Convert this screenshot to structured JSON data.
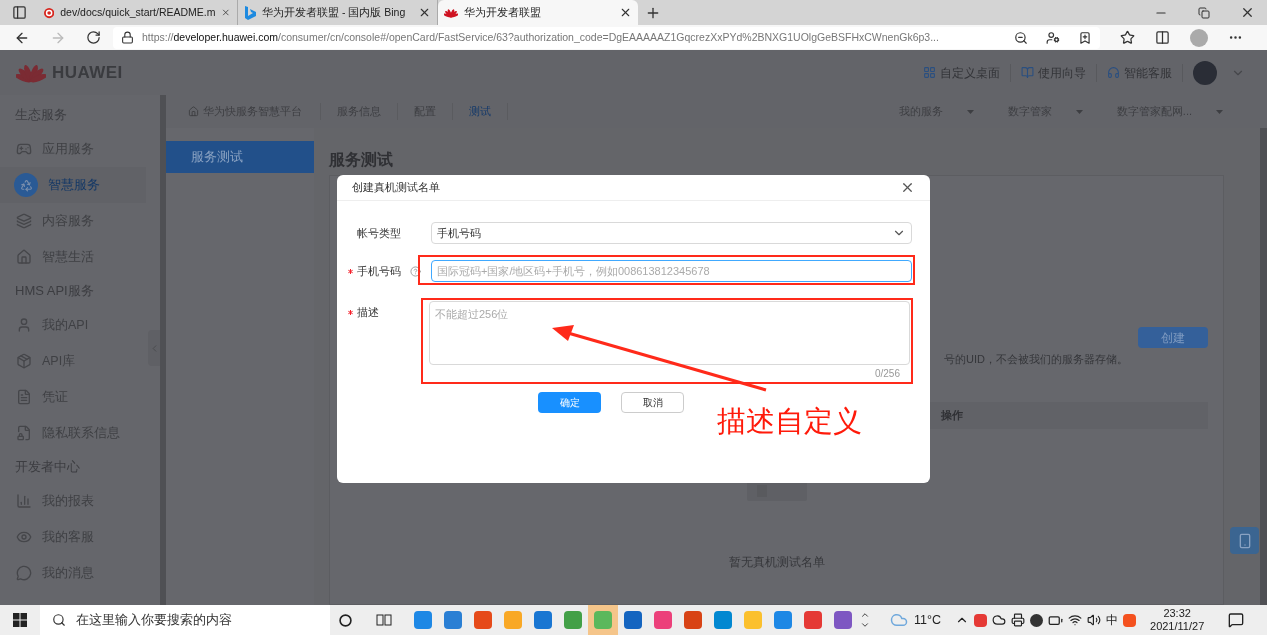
{
  "browser": {
    "tabs": [
      {
        "title": "dev/docs/quick_start/README.m",
        "selected": false
      },
      {
        "title": "华为开发者联盟 - 国内版 Bing",
        "selected": false
      },
      {
        "title": "华为开发者联盟",
        "selected": true
      }
    ],
    "url": {
      "scheme": "https://",
      "host": "developer.huawei.com",
      "path": "/consumer/cn/console#/openCard/FastService/63?authorization_code=DgEAAAAAZ1GqcrezXxPYd%2BNXG1UOlgGeBSFHxCWnenGk6p3..."
    }
  },
  "header": {
    "logo": "HUAWEI",
    "links": [
      {
        "label": "自定义桌面"
      },
      {
        "label": "使用向导"
      },
      {
        "label": "智能客服"
      }
    ]
  },
  "sidebar": {
    "sections": [
      {
        "title": "生态服务",
        "items": [
          {
            "label": "应用服务",
            "selected": false
          },
          {
            "label": "智慧服务",
            "selected": true
          },
          {
            "label": "内容服务",
            "selected": false
          },
          {
            "label": "智慧生活",
            "selected": false
          }
        ]
      },
      {
        "title": "HMS API服务",
        "items": [
          {
            "label": "我的API",
            "selected": false
          },
          {
            "label": "API库",
            "selected": false
          },
          {
            "label": "凭证",
            "selected": false
          },
          {
            "label": "隐私联系信息",
            "selected": false
          }
        ]
      },
      {
        "title": "开发者中心",
        "items": [
          {
            "label": "我的报表",
            "selected": false
          },
          {
            "label": "我的客服",
            "selected": false
          },
          {
            "label": "我的消息",
            "selected": false
          }
        ]
      }
    ]
  },
  "breadcrumb": {
    "home": "华为快服务智慧平台",
    "tabs": [
      {
        "label": "服务信息",
        "selected": false
      },
      {
        "label": "配置",
        "selected": false
      },
      {
        "label": "测试",
        "selected": true
      }
    ],
    "menus": [
      "我的服务",
      "数字管家",
      "数字管家配网..."
    ]
  },
  "subnav": [
    {
      "label": "服务测试",
      "selected": true
    }
  ],
  "page": {
    "title": "服务测试",
    "create_button": "创建",
    "note": "号的UID，不会被我们的服务器存储。",
    "table": {
      "columns": [
        "操作"
      ]
    },
    "empty_text": "暂无真机测试名单"
  },
  "dialog": {
    "title": "创建真机测试名单",
    "fields": [
      {
        "kind": "select",
        "label": "帐号类型",
        "required": false,
        "value": "手机号码"
      },
      {
        "kind": "input",
        "label": "手机号码",
        "required": true,
        "help": true,
        "focused": true,
        "placeholder": "国际冠码+国家/地区码+手机号，例如008613812345678"
      },
      {
        "kind": "textarea",
        "label": "描述",
        "required": true,
        "placeholder": "不能超过256位",
        "counter": "0/256"
      }
    ],
    "buttons": [
      {
        "label": "确定",
        "kind": "primary"
      },
      {
        "label": "取消",
        "kind": "default"
      }
    ]
  },
  "annotation": {
    "text": "描述自定义"
  },
  "taskbar": {
    "search_placeholder": "在这里输入你要搜索的内容",
    "weather": "11°C",
    "ime": "中",
    "time": "23:32",
    "date": "2021/11/27"
  }
}
